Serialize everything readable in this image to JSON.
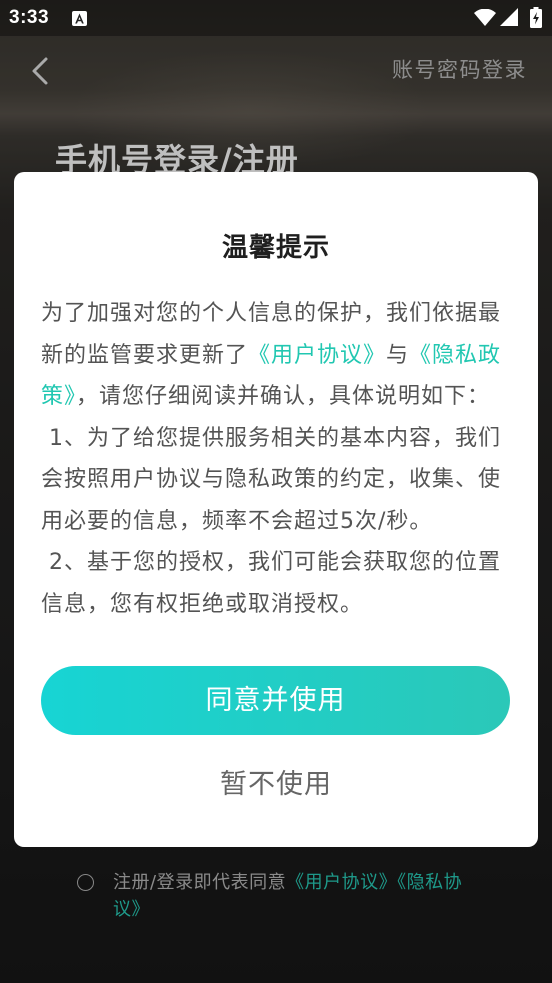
{
  "status_bar": {
    "time": "3:33",
    "icons": [
      "notification-a-icon",
      "wifi-icon",
      "signal-icon",
      "battery-charging-icon"
    ]
  },
  "nav": {
    "back_icon": "chevron-left-icon",
    "account_login_link": "账号密码登录"
  },
  "page": {
    "title": "手机号登录/注册"
  },
  "agreement": {
    "checked": false,
    "prefix": "注册/登录即代表同意",
    "user_agreement_link": "《用户协议》",
    "privacy_link": "《隐私协议》"
  },
  "dialog": {
    "title": "温馨提示",
    "intro": {
      "text_before": "为了加强对您的个人信息的保护，我们依据最新的监管要求更新了",
      "user_agreement_link": "《用户协议》",
      "text_between": "与",
      "privacy_link": "《隐私政策》",
      "text_after": "，请您仔细阅读并确认，具体说明如下："
    },
    "items": [
      " 1、为了给您提供服务相关的基本内容，我们会按照用户协议与隐私政策的约定，收集、使用必要的信息，频率不会超过5次/秒。",
      " 2、基于您的授权，我们可能会获取您的位置信息，您有权拒绝或取消授权。"
    ],
    "agree_button": "同意并使用",
    "decline_button": "暂不使用"
  },
  "colors": {
    "accent": "#21c7b1",
    "button_gradient_start": "#17d4d4",
    "button_gradient_end": "#2bc8b8",
    "dialog_background": "#ffffff"
  }
}
